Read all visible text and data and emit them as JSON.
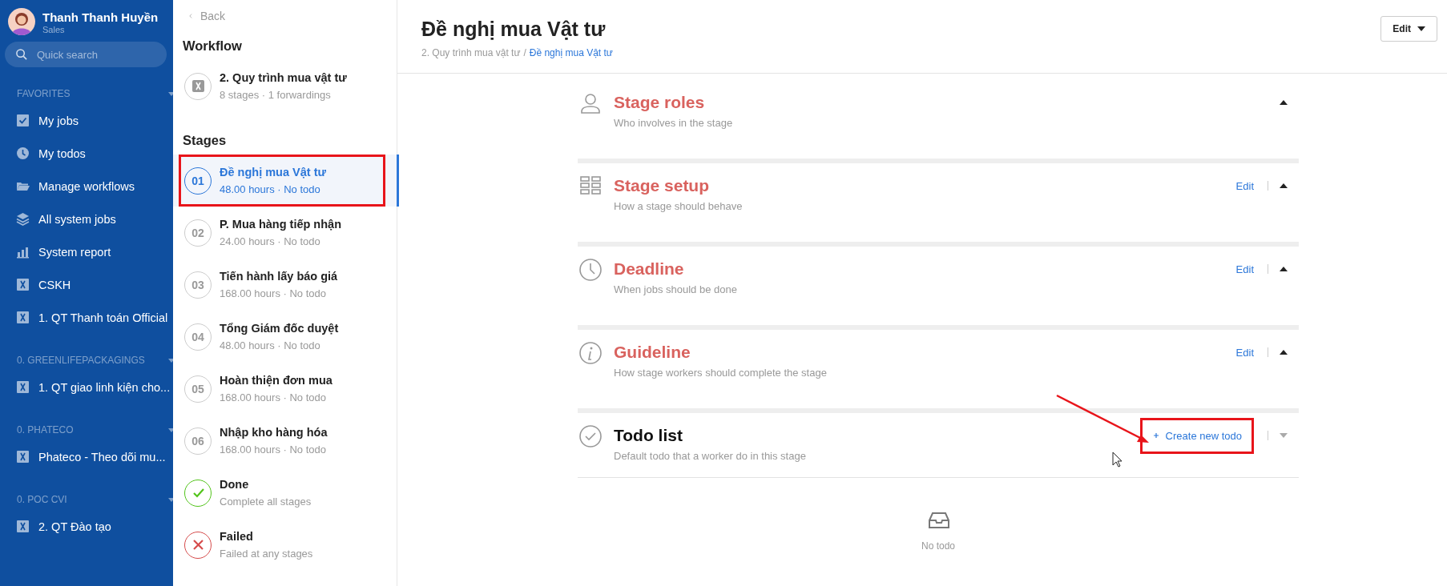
{
  "user": {
    "name": "Thanh Thanh Huyền",
    "role": "Sales"
  },
  "search": {
    "placeholder": "Quick search"
  },
  "sidebar": {
    "groups": [
      {
        "title": "FAVORITES",
        "items": [
          {
            "kind": "check",
            "label": "My jobs"
          },
          {
            "kind": "clock",
            "label": "My todos"
          },
          {
            "kind": "folder",
            "label": "Manage workflows"
          },
          {
            "kind": "layers",
            "label": "All system jobs"
          },
          {
            "kind": "chart",
            "label": "System report"
          },
          {
            "kind": "workflow",
            "label": "CSKH"
          },
          {
            "kind": "workflow",
            "label": "1. QT Thanh toán Official"
          }
        ]
      },
      {
        "title": "0. GREENLIFEPACKAGINGS",
        "items": [
          {
            "kind": "workflow",
            "label": "1. QT giao linh kiện cho..."
          }
        ]
      },
      {
        "title": "0. PHATECO",
        "items": [
          {
            "kind": "workflow",
            "label": "Phateco - Theo dõi mu..."
          }
        ]
      },
      {
        "title": "0. POC CVI",
        "items": [
          {
            "kind": "workflow",
            "label": "2. QT Đào tạo"
          }
        ]
      }
    ]
  },
  "stages_panel": {
    "back": "Back",
    "workflow_heading": "Workflow",
    "workflow": {
      "name": "2. Quy trình mua vật tư",
      "meta": "8 stages · 1 forwardings"
    },
    "stages_heading": "Stages",
    "stages": [
      {
        "kind": "number",
        "number": "01",
        "name": "Đề nghị mua Vật tư",
        "meta": "48.00 hours · No todo",
        "selected": true,
        "highlighted": true
      },
      {
        "kind": "number",
        "number": "02",
        "name": "P. Mua hàng tiếp nhận",
        "meta": "24.00 hours · No todo",
        "selected": false,
        "highlighted": false
      },
      {
        "kind": "number",
        "number": "03",
        "name": "Tiến hành lấy báo giá",
        "meta": "168.00 hours · No todo",
        "selected": false,
        "highlighted": false
      },
      {
        "kind": "number",
        "number": "04",
        "name": "Tổng Giám đốc duyệt",
        "meta": "48.00 hours · No todo",
        "selected": false,
        "highlighted": false
      },
      {
        "kind": "number",
        "number": "05",
        "name": "Hoàn thiện đơn mua",
        "meta": "168.00 hours · No todo",
        "selected": false,
        "highlighted": false
      },
      {
        "kind": "number",
        "number": "06",
        "name": "Nhập kho hàng hóa",
        "meta": "168.00 hours · No todo",
        "selected": false,
        "highlighted": false
      },
      {
        "kind": "done",
        "name": "Done",
        "meta": "Complete all stages",
        "selected": false,
        "highlighted": false
      },
      {
        "kind": "failed",
        "name": "Failed",
        "meta": "Failed at any stages",
        "selected": false,
        "highlighted": false
      }
    ]
  },
  "header": {
    "title": "Đề nghị mua Vật tư",
    "breadcrumb": [
      {
        "label": "2. Quy trình mua vật tư",
        "link": false
      },
      {
        "label": "Đề nghị mua Vật tư",
        "link": true
      }
    ],
    "breadcrumb_separator": "/",
    "edit_button": "Edit"
  },
  "sections": [
    {
      "kind": "person",
      "title": "Stage roles",
      "subtitle": "Who involves in the stage",
      "color": "#d9625e",
      "expanded": true
    },
    {
      "kind": "grid",
      "title": "Stage setup",
      "subtitle": "How a stage should behave",
      "color": "#d9625e",
      "action": "Edit",
      "expanded": true
    },
    {
      "kind": "clock",
      "title": "Deadline",
      "subtitle": "When jobs should be done",
      "color": "#d9625e",
      "action": "Edit",
      "expanded": true
    },
    {
      "kind": "info",
      "title": "Guideline",
      "subtitle": "How stage workers should complete the stage",
      "color": "#d9625e",
      "action": "Edit",
      "expanded": true
    },
    {
      "kind": "check",
      "title": "Todo list",
      "subtitle": "Default todo that a worker do in this stage",
      "color": "#111111",
      "create_button": "Create new todo",
      "highlighted": true,
      "arrow": true,
      "expanded": false,
      "empty_text": "No todo"
    }
  ]
}
